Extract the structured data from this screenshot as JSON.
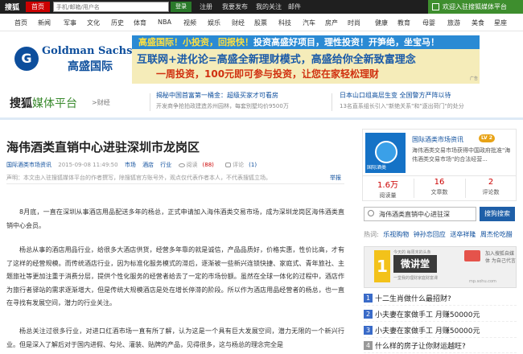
{
  "topbar": {
    "brand": "搜狐",
    "home_tab": "首页",
    "search_placeholder": "手机/邮箱/用户名",
    "login_button": "登录",
    "register": "注册",
    "want_post": "我要发布",
    "my_focus": "我的关注",
    "mail": "邮件",
    "welcome": "欢迎入驻搜狐媒体平台"
  },
  "nav": [
    "首页",
    "新闻",
    "军事",
    "文化",
    "历史",
    "体育",
    "NBA",
    "视频",
    "娱乐",
    "财经",
    "股票",
    "科技",
    "汽车",
    "房产",
    "时尚",
    "健康",
    "教育",
    "母婴",
    "旅游",
    "美食",
    "星座"
  ],
  "logo": {
    "mark": "G",
    "en": "Goldman Sachs",
    "cn": "高盛国际"
  },
  "banner": {
    "line1_a": "高盛国际！小投资，回报快！",
    "line1_b": "投资高盛好项目，理性投资！开笋绝，坐宝马！",
    "line2": "互联网+进化论=高盛全新理财模式，高盛给你全新致富理念",
    "line3": "一周投资，100元即可参与投资，让您在家轻松理财",
    "ad_label": "广告"
  },
  "channel": {
    "sohu": "搜狐",
    "media": "媒体平台",
    "sub": ">财经",
    "promo1_title": "揭秘中国首富第一桶金：超级买家才可看房",
    "promo1_desc": "开发商争抢拍政建造苏州园林，每套别墅均价9500万",
    "promo2_title": "日本山口组高层生变 全国警方严阵以待",
    "promo2_desc": "13名直系组长引入\"新绝关系\"和\"逐出荷门\"的处分"
  },
  "article": {
    "title": "海伟酒类直销中心进驻深圳市龙岗区",
    "source": "国际酒类市场资讯",
    "date": "2015-09-08 11:49:50",
    "tag1": "市场",
    "tag2": "酒店",
    "tag3": "行业",
    "views_label": "阅读",
    "views": "(88)",
    "comments_label": "评论",
    "comments": "(1)",
    "disclaimer": "声明：本文由入驻搜狐媒体平台的作者撰写，除搜狐官方账号外，观点仅代表作者本人，不代表搜狐立场。",
    "report": "举报",
    "p1": "8月底，一直在深圳从事酒店用品配送多年的杨总，正式申请加入海伟酒类交易市场，成为深圳龙岗区海伟酒类直销中心会员。",
    "p2": "杨总从事的酒店用品行业，给很多大酒店供货，经营多年靠的就是诚信，产品品质好，价格实惠，性价比高，才有了这样的经营规模。而传统酒店行业，因为标准化服务模式的滞后，逐渐被一些新兴连锁快捷、家庭式、青年旅社、主题旅社等更加注重于消费分层，提供个性化服务的经营者给去了一定的市场份额。虽然在全球一体化的过程中，酒店作为旅行者驿站的需求逐渐增大，但是传统大规模酒店是处在增长停滞的阶段。所以作为酒店用品经营者的杨总，也一直在寻找有发展空间，潜力的行业关注。",
    "p3": "杨总关注过很多行业，对进口红酒市场一直有所了解，认为这是一个具有巨大发展空间，潜力无限的一个新兴行业。但是深入了解后对于国内进假、勾兑、灌装、贴牌的产品，见得很多，这与杨总的理念完全是"
  },
  "sidebar": {
    "avatar_caption": "国际酒类",
    "name": "国际酒类市场资讯",
    "level": "LV 2",
    "desc": "海伟酒类交易市场获得中国政府批准\"海伟酒类交易市场\"的合法经营...",
    "stats": [
      {
        "n": "1.6万",
        "l": "阅读量"
      },
      {
        "n": "16",
        "l": "文章数"
      },
      {
        "n": "2",
        "l": "评论数"
      }
    ],
    "search_value": "海伟酒类直销中心进驻深",
    "search_button": "搜狗搜索",
    "hot_label": "热词:",
    "hot_words": [
      "乐视购物",
      "钟孙恋回应",
      "送卒祥隆",
      "周杰伦吃醋"
    ],
    "ad_left_top": "今天的 每周末的头条",
    "ad_gold": "1",
    "ad_dark": "微讲堂",
    "ad_small": "一堂我的理财家庭财富课",
    "ad_right": "加入搜狐自媒体 为自己代言",
    "ad_right2": "mp.sohu.com",
    "rank": [
      {
        "n": "1",
        "t": "十二生肖做什么最招财?"
      },
      {
        "n": "2",
        "t": "小夫妻在家做手工 月赚50000元"
      },
      {
        "n": "3",
        "t": "小夫妻在家做手工 月赚50000元"
      },
      {
        "n": "4",
        "t": "什么样的房子让你财运越旺?"
      }
    ]
  },
  "colors": {
    "accent_green": "#3e8e2e",
    "accent_red": "#c00",
    "sohu_blue": "#0d4e9c"
  }
}
